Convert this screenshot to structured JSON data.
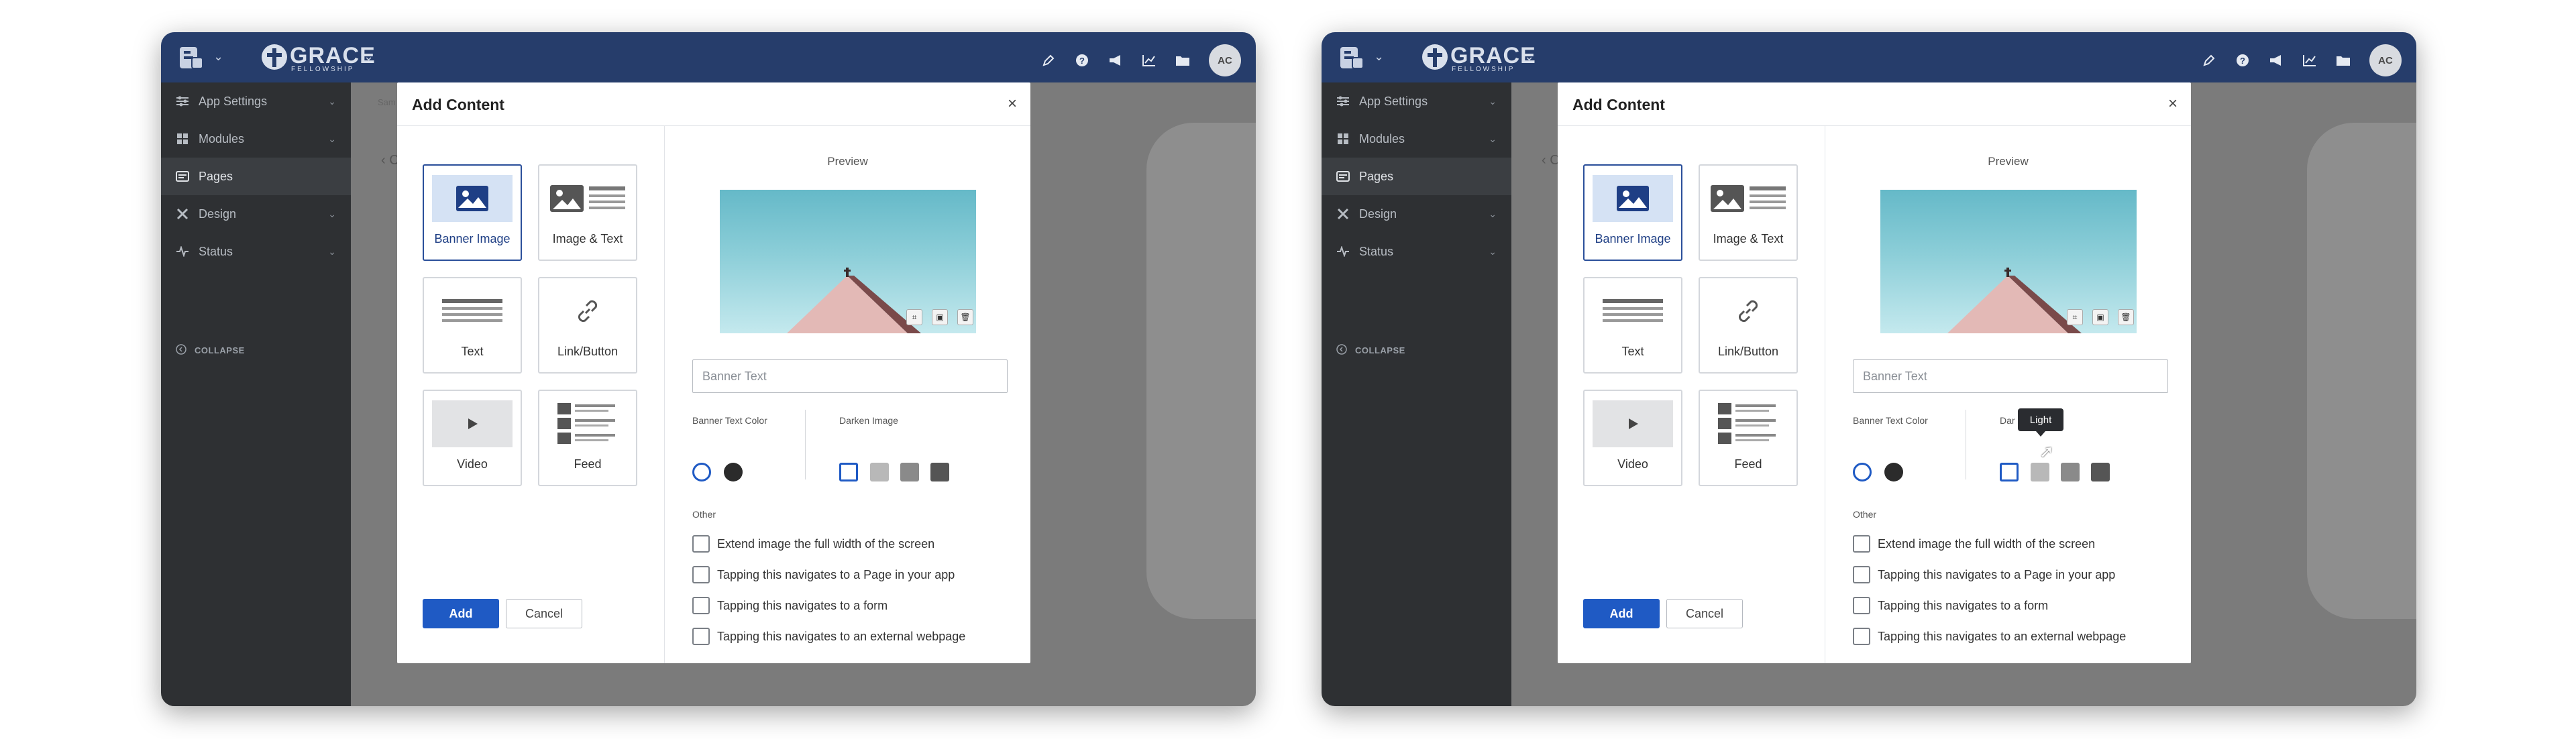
{
  "header": {
    "logo_main": "GRACE",
    "logo_sub": "FELLOWSHIP",
    "avatar_initials": "AC"
  },
  "sidebar": {
    "items": [
      {
        "label": "App Settings",
        "icon": "sliders-icon",
        "has_chevron": true
      },
      {
        "label": "Modules",
        "icon": "grid-icon",
        "has_chevron": true
      },
      {
        "label": "Pages",
        "icon": "pages-icon",
        "has_chevron": false
      },
      {
        "label": "Design",
        "icon": "design-tools-icon",
        "has_chevron": true
      },
      {
        "label": "Status",
        "icon": "pulse-icon",
        "has_chevron": true
      }
    ],
    "active_index": 2,
    "collapse_label": "COLLAPSE"
  },
  "background": {
    "crumb": "Sam",
    "back": "‹ C"
  },
  "modal": {
    "title": "Add Content",
    "close": "×",
    "tiles": [
      {
        "label": "Banner Image",
        "selected": true
      },
      {
        "label": "Image & Text",
        "selected": false
      },
      {
        "label": "Text",
        "selected": false
      },
      {
        "label": "Link/Button",
        "selected": false
      },
      {
        "label": "Video",
        "selected": false
      },
      {
        "label": "Feed",
        "selected": false
      }
    ],
    "add_label": "Add",
    "cancel_label": "Cancel",
    "preview_label": "Preview",
    "banner_text_placeholder": "Banner Text",
    "banner_text_color_label": "Banner Text Color",
    "darken_label": "Darken Image",
    "darken_label_partial": "Dar",
    "other_label": "Other",
    "options": [
      "Extend image the full width of the screen",
      "Tapping this navigates to a Page in your app",
      "Tapping this navigates to a form",
      "Tapping this navigates to an external webpage"
    ],
    "tooltip": "Light"
  },
  "colors": {
    "topbar": "#263d6b",
    "sidebar": "#2e3033",
    "accent": "#1f5ac4",
    "selected_border": "#2a4f9a"
  }
}
